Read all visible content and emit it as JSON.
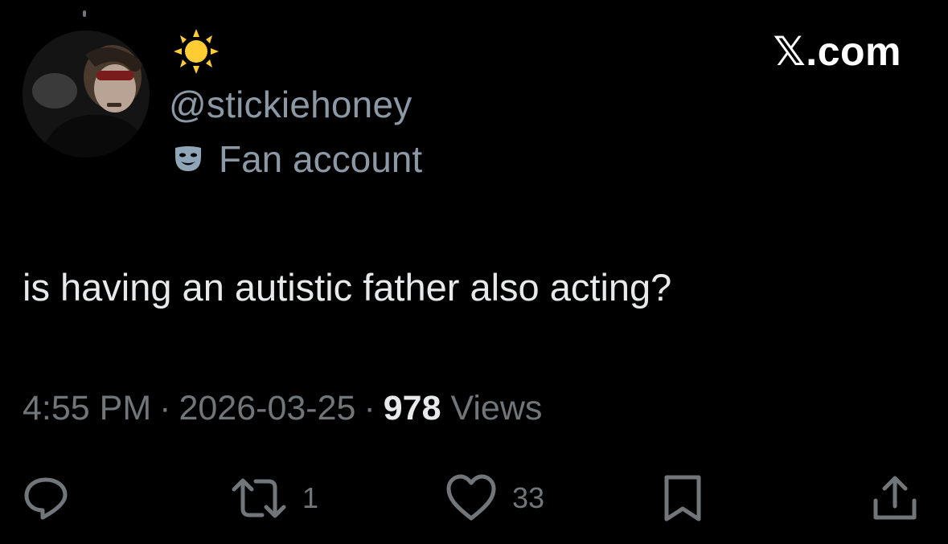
{
  "author": {
    "display_name_icon": "sun-icon",
    "handle": "@stickiehoney",
    "label_icon": "theater-mask-icon",
    "label": "Fan account"
  },
  "brand": "𝕏.com",
  "tweet": {
    "text": "is having an autistic father also acting?",
    "time": "4:55 PM",
    "date": "2026-03-25",
    "separator": "·",
    "views_count": "978",
    "views_label": "Views"
  },
  "actions": {
    "reply": {
      "icon": "reply-icon"
    },
    "retweet": {
      "icon": "retweet-icon",
      "count": "1"
    },
    "like": {
      "icon": "heart-icon",
      "count": "33"
    },
    "bookmark": {
      "icon": "bookmark-icon"
    },
    "share": {
      "icon": "share-icon"
    }
  },
  "colors": {
    "background": "#000000",
    "primary_text": "#e7e9ea",
    "secondary_text": "#71767b",
    "handle_text": "#8b98a5",
    "sun": "#ffcc33",
    "mask": "#8fa6b8"
  }
}
